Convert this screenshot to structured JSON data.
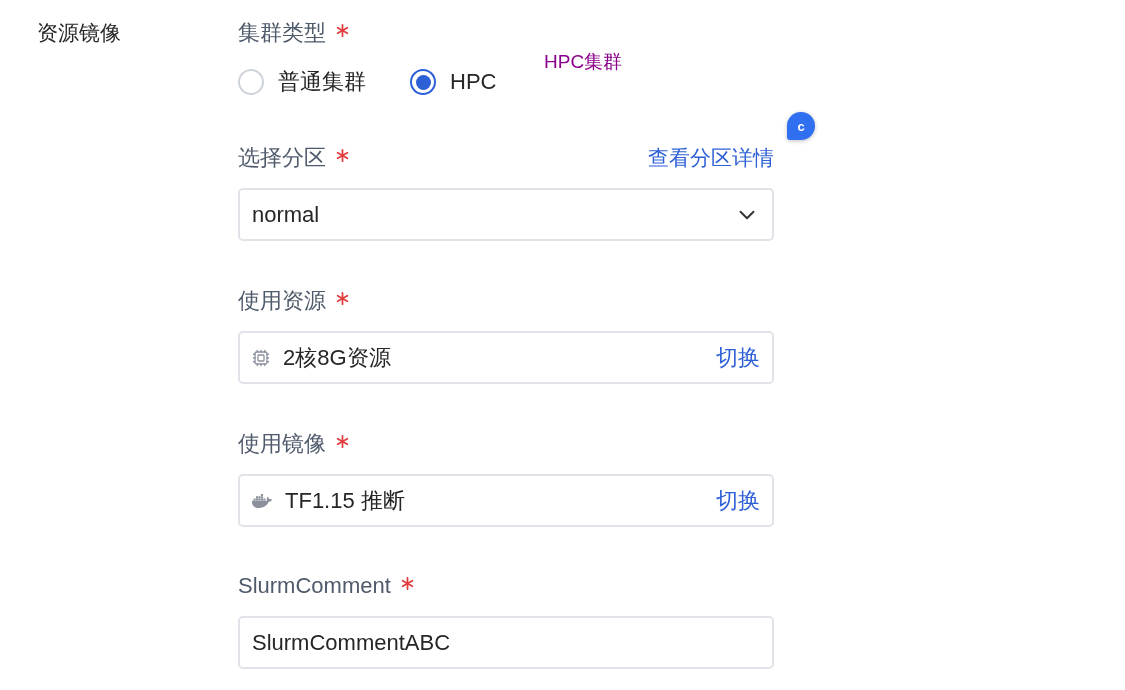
{
  "section": {
    "title": "资源镜像"
  },
  "fields": [
    {
      "kind": "radio",
      "label": "集群类型",
      "required": true,
      "options": [
        {
          "label": "普通集群",
          "selected": false
        },
        {
          "label": "HPC",
          "selected": true
        }
      ]
    },
    {
      "kind": "select",
      "label": "选择分区",
      "required": true,
      "link": "查看分区详情",
      "value": "normal"
    },
    {
      "kind": "resource",
      "label": "使用资源",
      "required": true,
      "value": "2核8G资源",
      "action": "切换"
    },
    {
      "kind": "image",
      "label": "使用镜像",
      "required": true,
      "value": "TF1.15 推断",
      "action": "切换"
    },
    {
      "kind": "text",
      "label": "SlurmComment",
      "required": true,
      "value": "SlurmCommentABC"
    }
  ],
  "annotation": {
    "text": "HPC集群"
  },
  "assistant_badge": {
    "label": "c"
  }
}
